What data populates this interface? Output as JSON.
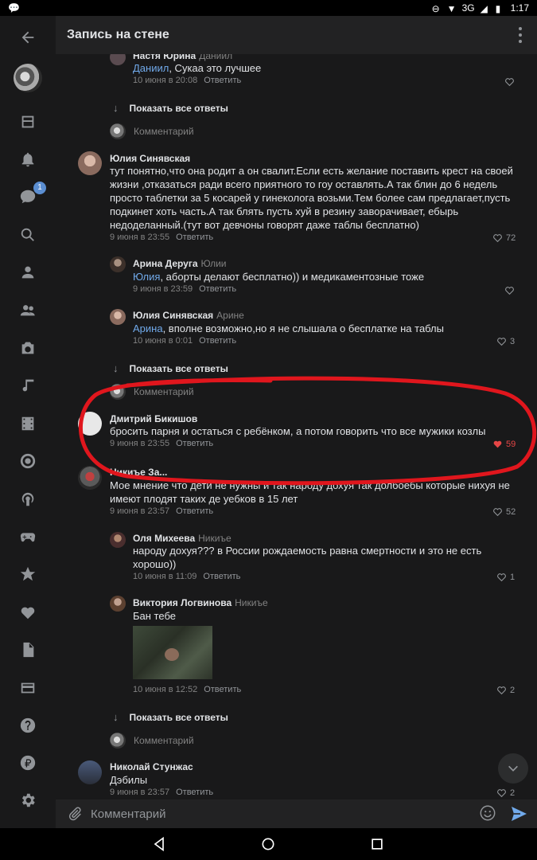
{
  "status_bar": {
    "network": "3G",
    "time": "1:17"
  },
  "header": {
    "title": "Запись на стене"
  },
  "rail": {
    "messages_badge": "1"
  },
  "comments": [
    {
      "id": "c0",
      "author": "Настя Юрина",
      "reply_to": "Даниил",
      "mention": "Даниил",
      "text": ", Сукаа это лучшее",
      "date": "10 июня в 20:08",
      "reply_label": "Ответить",
      "likes": ""
    },
    {
      "id": "c1",
      "author": "Юлия Синявская",
      "reply_to": "",
      "text": "тут понятно,что она родит а он свалит.Если есть желание поставить крест на своей жизни ,отказаться ради всего приятного то гоу оставлять.А так блин до 6 недель просто таблетки за 5 косарей у гинеколога возьми.Тем более сам предлагает,пусть подкинет хоть часть.А так блять пусть хуй в резину заворачивает, ебырь недоделанный.(тут вот девчоны говорят даже таблы бесплатно)",
      "date": "9 июня в 23:55",
      "reply_label": "Ответить",
      "likes": "72"
    },
    {
      "id": "c2",
      "author": "Арина Деруга",
      "reply_to": "Юлии",
      "mention": "Юлия",
      "text": ", аборты делают бесплатно)) и медикаментозные тоже",
      "date": "9 июня в 23:59",
      "reply_label": "Ответить",
      "likes": ""
    },
    {
      "id": "c3",
      "author": "Юлия Синявская",
      "reply_to": "Арине",
      "mention": "Арина",
      "text": ", вполне возможно,но я не слышала о бесплатке на таблы",
      "date": "10 июня в 0:01",
      "reply_label": "Ответить",
      "likes": "3"
    },
    {
      "id": "c4",
      "author": "Дмитрий Бикишов",
      "reply_to": "",
      "text": "бросить парня и остаться с ребёнком, а потом говорить что все мужики козлы",
      "date": "9 июня в 23:55",
      "reply_label": "Ответить",
      "likes": "59"
    },
    {
      "id": "c5",
      "author": "Никиъе За...",
      "reply_to": "",
      "text": "Мое мнение что дети не нужны и так народу дохуя так долбоебы которые нихуя не имеют плодят таких де уебков в 15 лет",
      "date": "9 июня в 23:57",
      "reply_label": "Ответить",
      "likes": "52"
    },
    {
      "id": "c6",
      "author": "Оля Михеева",
      "reply_to": "Никиъе",
      "text": "народу дохуя??? в России рождаемость равна смертности и это не есть хорошо))",
      "date": "10 июня в 11:09",
      "reply_label": "Ответить",
      "likes": "1"
    },
    {
      "id": "c7",
      "author": "Виктория Логвинова",
      "reply_to": "Никиъе",
      "text": "Бан тебе",
      "date": "10 июня в 12:52",
      "reply_label": "Ответить",
      "likes": "2"
    },
    {
      "id": "c8",
      "author": "Николай Стунжас",
      "reply_to": "",
      "text": "Дэбилы",
      "date": "9 июня в 23:57",
      "reply_label": "Ответить",
      "likes": "2"
    }
  ],
  "show_all_label": "Показать все ответы",
  "comment_placeholder_label": "Комментарий",
  "composer": {
    "placeholder": "Комментарий"
  }
}
